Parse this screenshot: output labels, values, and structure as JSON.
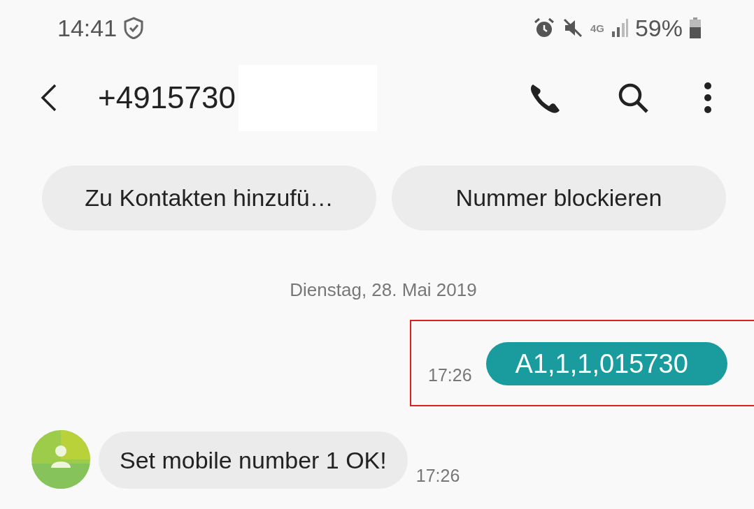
{
  "status_bar": {
    "time": "14:41",
    "network": "4G",
    "battery": "59%"
  },
  "header": {
    "title": "+4915730"
  },
  "actions": [
    {
      "label": "Zu Kontakten hinzufü…"
    },
    {
      "label": "Nummer blockieren"
    }
  ],
  "date": "Dienstag, 28. Mai 2019",
  "messages": [
    {
      "kind": "outgoing",
      "text": "A1,1,1,015730",
      "time": "17:26",
      "highlighted": true
    },
    {
      "kind": "incoming",
      "text": "Set mobile number 1 OK!",
      "time": "17:26",
      "highlighted": false
    }
  ]
}
